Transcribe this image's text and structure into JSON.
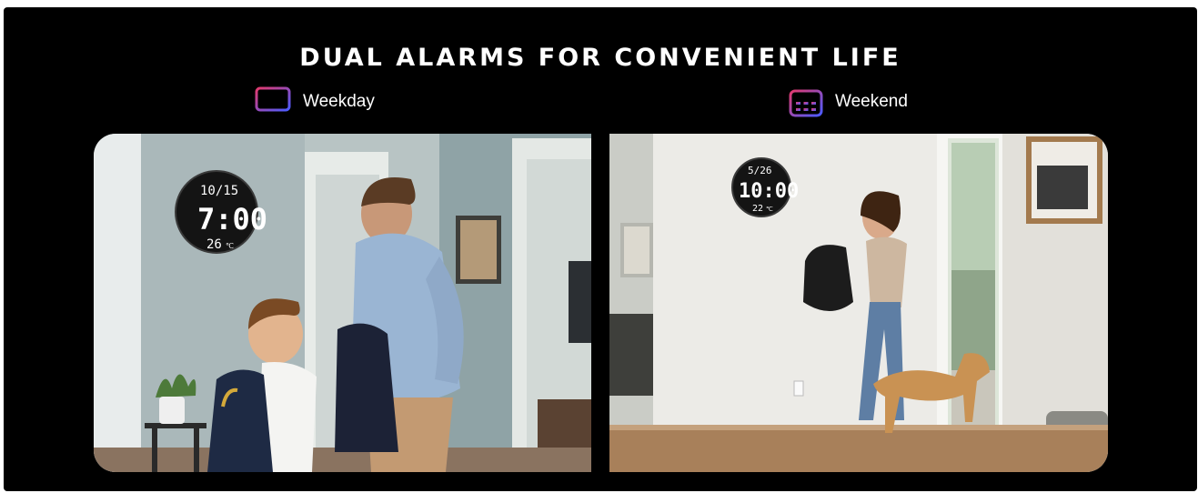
{
  "title": "DUAL ALARMS FOR CONVENIENT LIFE",
  "weekday": {
    "label": "Weekday",
    "icon": "monitor-icon",
    "clock": {
      "date": "10/15",
      "time": "7:00",
      "temp": "26",
      "unit": "℃"
    }
  },
  "weekend": {
    "label": "Weekend",
    "icon": "calendar-icon",
    "clock": {
      "date": "5/26",
      "time": "10:00",
      "temp": "22",
      "unit": "℃"
    }
  },
  "colors": {
    "background": "#000000",
    "text": "#ffffff",
    "icon_gradient_start": "#e23a6e",
    "icon_gradient_end": "#4b5bff"
  }
}
